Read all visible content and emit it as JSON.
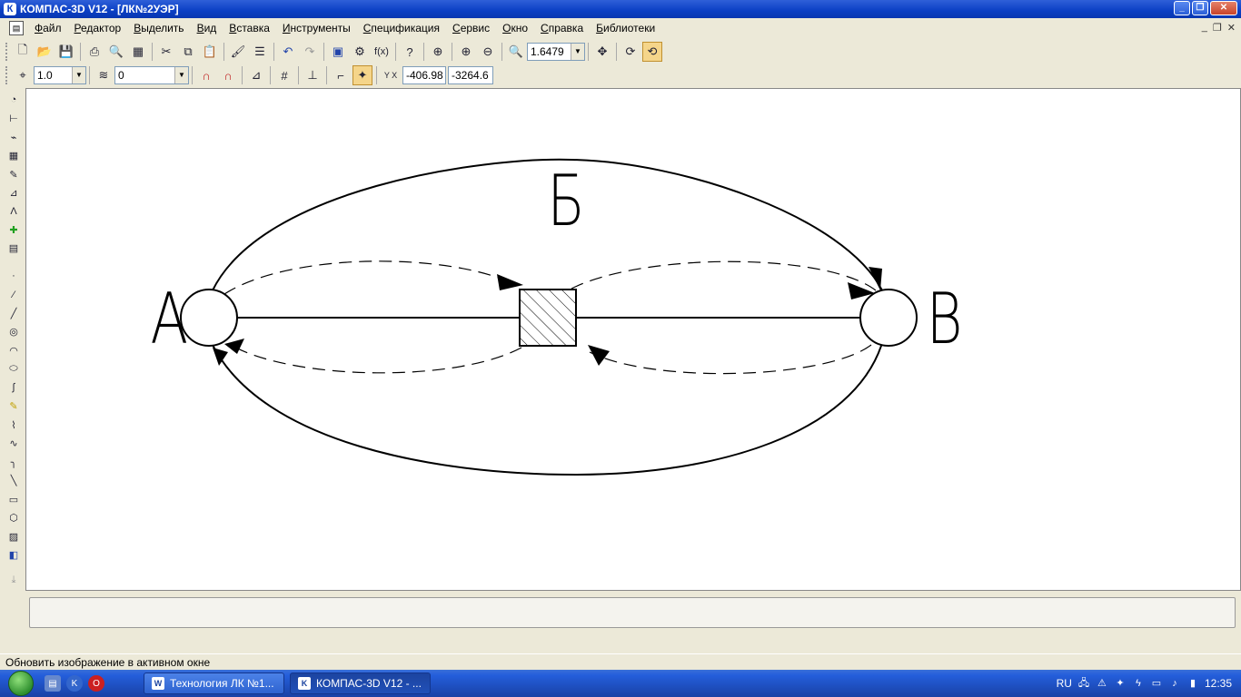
{
  "window": {
    "title": "КОМПАС-3D V12 - [ЛК№2УЭР]",
    "app_icon": "К"
  },
  "menu": [
    {
      "label": "Файл"
    },
    {
      "label": "Редактор"
    },
    {
      "label": "Выделить"
    },
    {
      "label": "Вид"
    },
    {
      "label": "Вставка"
    },
    {
      "label": "Инструменты"
    },
    {
      "label": "Спецификация"
    },
    {
      "label": "Сервис"
    },
    {
      "label": "Окно"
    },
    {
      "label": "Справка"
    },
    {
      "label": "Библиотеки"
    }
  ],
  "toolbar1": {
    "zoom_value": "1.6479"
  },
  "toolbar2": {
    "line_scale": "1.0",
    "layer": "0",
    "coord_x": "-406.98",
    "coord_y": "-3264.6",
    "coord_icon_label": "Y X"
  },
  "drawing": {
    "label_a": "А",
    "label_b": "Б",
    "label_v": "В"
  },
  "status": {
    "text": "Обновить изображение в активном окне"
  },
  "taskbar": {
    "tasks": [
      {
        "label": "Технология ЛК №1...",
        "icon": "W"
      },
      {
        "label": "КОМПАС-3D V12 - ...",
        "icon": "K"
      }
    ],
    "lang": "RU",
    "clock": "12:35"
  },
  "colors": {
    "title_bar": "#0A3FC4",
    "taskbar": "#245EDB",
    "canvas": "#ffffff"
  }
}
